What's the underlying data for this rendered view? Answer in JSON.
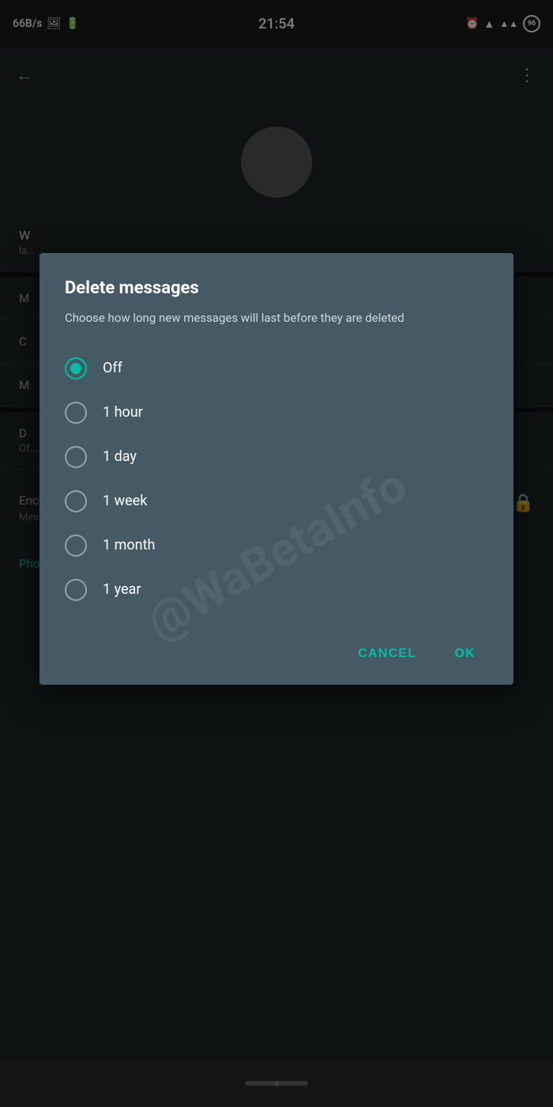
{
  "statusBar": {
    "speed": "66B/s",
    "time": "21:54",
    "battery": "96"
  },
  "topNav": {
    "backIcon": "←",
    "moreIcon": "⋮"
  },
  "dialog": {
    "title": "Delete messages",
    "subtitle": "Choose how long new messages will last before they are deleted",
    "options": [
      {
        "id": "off",
        "label": "Off",
        "selected": true
      },
      {
        "id": "1hour",
        "label": "1 hour",
        "selected": false
      },
      {
        "id": "1day",
        "label": "1 day",
        "selected": false
      },
      {
        "id": "1week",
        "label": "1 week",
        "selected": false
      },
      {
        "id": "1month",
        "label": "1 month",
        "selected": false
      },
      {
        "id": "1year",
        "label": "1 year",
        "selected": false
      }
    ],
    "cancelLabel": "CANCEL",
    "okLabel": "OK"
  },
  "bgContent": {
    "encryptionTitle": "Encryption",
    "encryptionSub": "Messages to this chat and calls are secured with end-to-end encryption. Tap to verify.",
    "phoneNumber": "Phone number"
  },
  "watermark": "@WaBetaInfo"
}
